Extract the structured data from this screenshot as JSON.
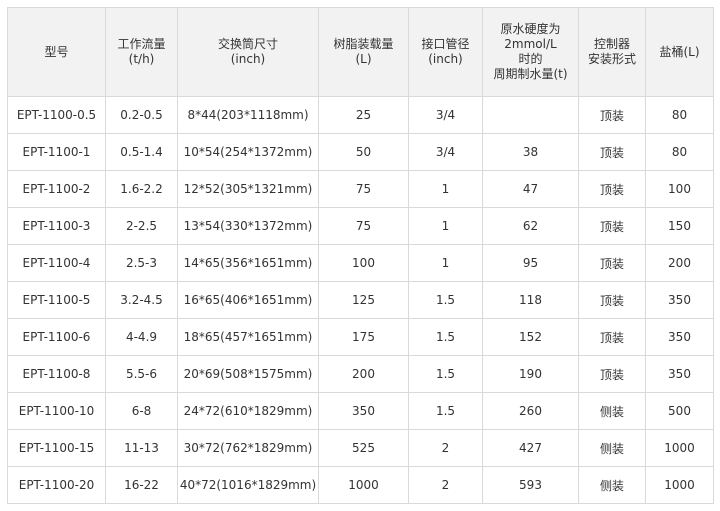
{
  "table": {
    "headers": [
      {
        "lines": [
          "型号"
        ]
      },
      {
        "lines": [
          "工作流量",
          "(t/h)"
        ]
      },
      {
        "lines": [
          "交换筒尺寸",
          "(inch)"
        ]
      },
      {
        "lines": [
          "树脂装载量",
          "(L)"
        ]
      },
      {
        "lines": [
          "接口管径",
          "(inch)"
        ]
      },
      {
        "lines": [
          "原水硬度为",
          "2mmol/L",
          "时的",
          "周期制水量(t)"
        ]
      },
      {
        "lines": [
          "控制器",
          "安装形式"
        ]
      },
      {
        "lines": [
          "盐桶(L)"
        ]
      }
    ],
    "rows": [
      [
        "EPT-1100-0.5",
        "0.2-0.5",
        "8*44(203*1118mm)",
        "25",
        "3/4",
        "",
        "顶装",
        "80"
      ],
      [
        "EPT-1100-1",
        "0.5-1.4",
        "10*54(254*1372mm)",
        "50",
        "3/4",
        "38",
        "顶装",
        "80"
      ],
      [
        "EPT-1100-2",
        "1.6-2.2",
        "12*52(305*1321mm)",
        "75",
        "1",
        "47",
        "顶装",
        "100"
      ],
      [
        "EPT-1100-3",
        "2-2.5",
        "13*54(330*1372mm)",
        "75",
        "1",
        "62",
        "顶装",
        "150"
      ],
      [
        "EPT-1100-4",
        "2.5-3",
        "14*65(356*1651mm)",
        "100",
        "1",
        "95",
        "顶装",
        "200"
      ],
      [
        "EPT-1100-5",
        "3.2-4.5",
        "16*65(406*1651mm)",
        "125",
        "1.5",
        "118",
        "顶装",
        "350"
      ],
      [
        "EPT-1100-6",
        "4-4.9",
        "18*65(457*1651mm)",
        "175",
        "1.5",
        "152",
        "顶装",
        "350"
      ],
      [
        "EPT-1100-8",
        "5.5-6",
        "20*69(508*1575mm)",
        "200",
        "1.5",
        "190",
        "顶装",
        "350"
      ],
      [
        "EPT-1100-10",
        "6-8",
        "24*72(610*1829mm)",
        "350",
        "1.5",
        "260",
        "侧装",
        "500"
      ],
      [
        "EPT-1100-15",
        "11-13",
        "30*72(762*1829mm)",
        "525",
        "2",
        "427",
        "侧装",
        "1000"
      ],
      [
        "EPT-1100-20",
        "16-22",
        "40*72(1016*1829mm)",
        "1000",
        "2",
        "593",
        "侧装",
        "1000"
      ]
    ]
  },
  "colors": {
    "header_bg": "#f2f2f2",
    "border": "#d9d9d9",
    "text": "#333333"
  }
}
